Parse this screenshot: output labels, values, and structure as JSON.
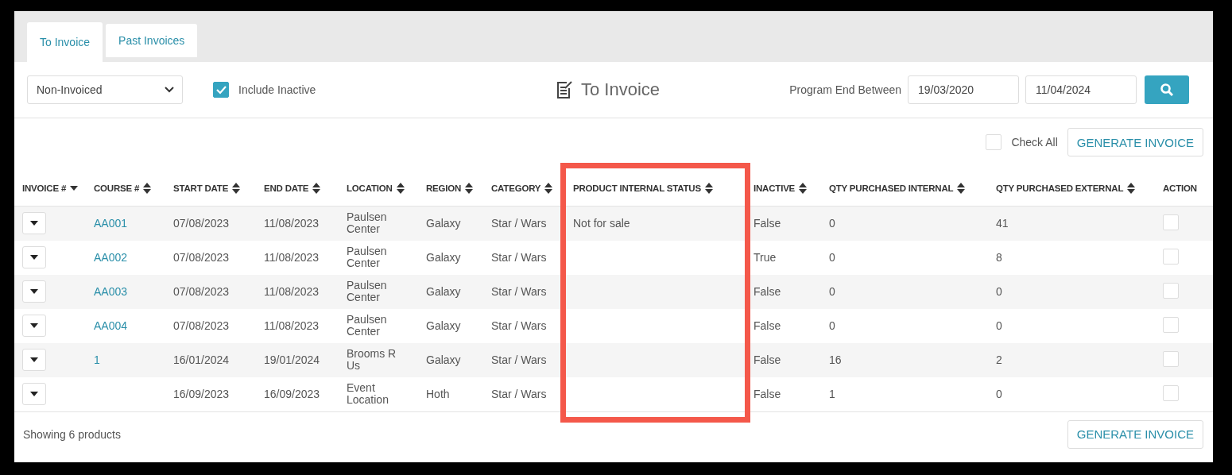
{
  "tabs": [
    {
      "label": "To Invoice",
      "selected": true
    },
    {
      "label": "Past Invoices",
      "selected": false
    }
  ],
  "toolbar": {
    "filter": {
      "value": "Non-Invoiced"
    },
    "include_inactive": {
      "label": "Include Inactive",
      "checked": true
    },
    "title": "To Invoice",
    "date_range": {
      "label": "Program End Between",
      "from": "19/03/2020",
      "to": "11/04/2024"
    }
  },
  "actions": {
    "check_all": {
      "label": "Check All",
      "checked": false
    },
    "generate_button": "GENERATE INVOICE"
  },
  "table": {
    "columns": [
      {
        "label": "INVOICE #",
        "kind": "sorted",
        "highlighted": false
      },
      {
        "label": "COURSE #",
        "kind": "sortable",
        "highlighted": false
      },
      {
        "label": "START DATE",
        "kind": "sortable",
        "highlighted": false
      },
      {
        "label": "END DATE",
        "kind": "sortable",
        "highlighted": false
      },
      {
        "label": "LOCATION",
        "kind": "sortable",
        "highlighted": false
      },
      {
        "label": "REGION",
        "kind": "sortable",
        "highlighted": false
      },
      {
        "label": "CATEGORY",
        "kind": "sortable",
        "highlighted": false
      },
      {
        "label": "PRODUCT INTERNAL STATUS",
        "kind": "sortable",
        "highlighted": true
      },
      {
        "label": "INACTIVE",
        "kind": "sortable",
        "highlighted": false
      },
      {
        "label": "QTY PURCHASED INTERNAL",
        "kind": "sortable",
        "highlighted": false
      },
      {
        "label": "QTY PURCHASED EXTERNAL",
        "kind": "sortable",
        "highlighted": false
      },
      {
        "label": "ACTION",
        "kind": "plain",
        "highlighted": false
      }
    ],
    "rows": [
      {
        "course": "AA001",
        "start": "07/08/2023",
        "end": "11/08/2023",
        "location": "Paulsen Center",
        "region": "Galaxy",
        "category": "Star / Wars",
        "status": "Not for sale",
        "inactive": "False",
        "qty_internal": "0",
        "qty_external": "41",
        "checked": false
      },
      {
        "course": "AA002",
        "start": "07/08/2023",
        "end": "11/08/2023",
        "location": "Paulsen Center",
        "region": "Galaxy",
        "category": "Star / Wars",
        "inactive": "True",
        "qty_internal": "0",
        "qty_external": "8",
        "checked": false
      },
      {
        "course": "AA003",
        "start": "07/08/2023",
        "end": "11/08/2023",
        "location": "Paulsen Center",
        "region": "Galaxy",
        "category": "Star / Wars",
        "inactive": "False",
        "qty_internal": "0",
        "qty_external": "0",
        "checked": false
      },
      {
        "course": "AA004",
        "start": "07/08/2023",
        "end": "11/08/2023",
        "location": "Paulsen Center",
        "region": "Galaxy",
        "category": "Star / Wars",
        "inactive": "False",
        "qty_internal": "0",
        "qty_external": "0",
        "checked": false
      },
      {
        "course": "1",
        "start": "16/01/2024",
        "end": "19/01/2024",
        "location": "Brooms R Us",
        "region": "Galaxy",
        "category": "Star / Wars",
        "inactive": "False",
        "qty_internal": "16",
        "qty_external": "2",
        "checked": false
      },
      {
        "start": "16/09/2023",
        "end": "16/09/2023",
        "location": "Event Location",
        "region": "Hoth",
        "category": "Star / Wars",
        "inactive": "False",
        "qty_internal": "1",
        "qty_external": "0",
        "checked": false
      }
    ]
  },
  "footer": {
    "summary": "Showing 6 products",
    "generate_button": "GENERATE INVOICE"
  }
}
